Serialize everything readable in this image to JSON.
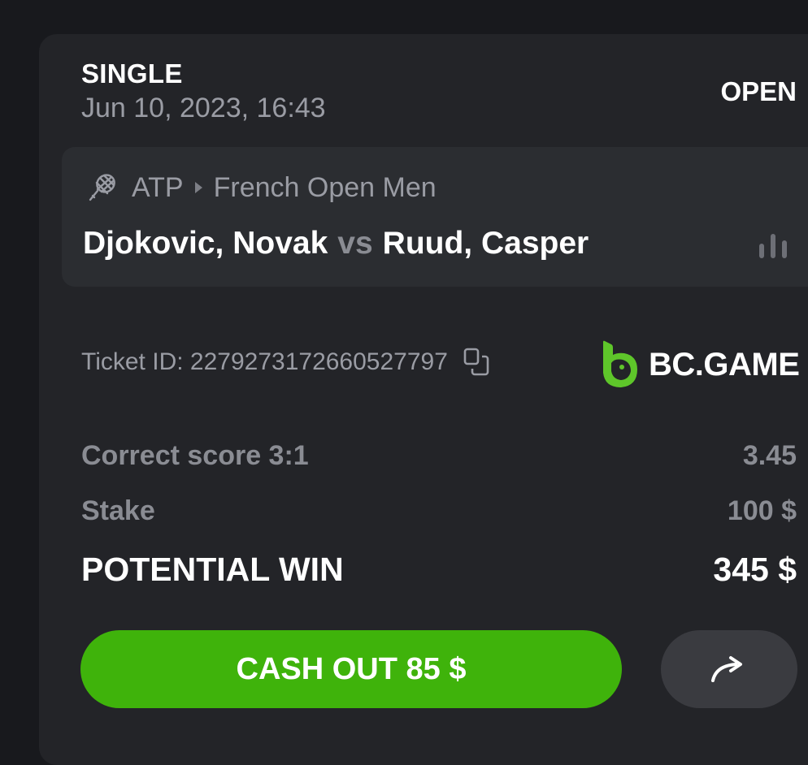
{
  "bet": {
    "type": "SINGLE",
    "date": "Jun 10, 2023, 16:43",
    "status": "OPEN"
  },
  "event": {
    "sport_icon": "tennis-racket-icon",
    "category": "ATP",
    "tournament": "French Open Men",
    "home": "Djokovic, Novak",
    "vs": "vs",
    "away": "Ruud, Casper"
  },
  "ticket": {
    "label": "Ticket ID: 2279273172660527797"
  },
  "brand": {
    "name": "BC.GAME",
    "color": "#5ec62a"
  },
  "selection": {
    "market": "Correct score 3:1",
    "odds": "3.45"
  },
  "stake": {
    "label": "Stake",
    "value": "100 $"
  },
  "potential_win": {
    "label": "POTENTIAL WIN",
    "value": "345 $"
  },
  "actions": {
    "cashout_label": "CASH OUT 85 $",
    "cashout_color": "#3fb30b",
    "share_icon": "share-arrow-icon"
  }
}
